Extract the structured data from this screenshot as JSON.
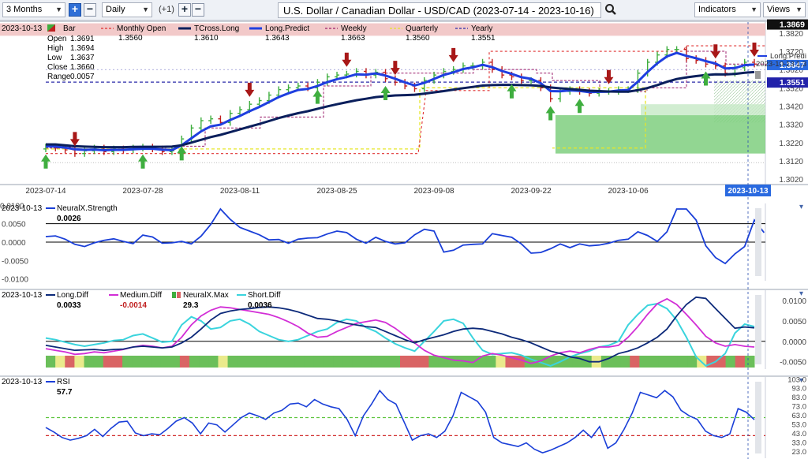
{
  "toolbar": {
    "period": "3 Months",
    "interval": "Daily",
    "offset": "(+1)",
    "title": "U.S. Dollar / Canadian Dollar - USD/CAD (2023-07-14 - 2023-10-16)",
    "indicators": "Indicators",
    "views": "Views"
  },
  "colors": {
    "tcross": "#0a1f5c",
    "longpredict": "#1f3fe0",
    "neuralx": "#1a3fd8",
    "longdiff": "#0d2a7a",
    "mediumdiff": "#d22ed6",
    "shortdiff": "#3ad4dd",
    "rsi": "#1a3fd8",
    "up": "#3fae3f",
    "down": "#c02020",
    "monthly": "#e03030",
    "weekly": "#9c1f6c",
    "quarterly": "#e6e62a",
    "yearly": "#2a2aa8"
  },
  "chart_data": [
    {
      "type": "line",
      "panel": "price",
      "title": "U.S. Dollar / Canadian Dollar - USD/CAD (2023-07-14 - 2023-10-16)",
      "date_label": "2023-10-13",
      "legend": [
        "Bar",
        "Monthly Open",
        "TCross.Long",
        "Long.Predict",
        "Weekly",
        "Quarterly",
        "Yearly"
      ],
      "ohlc_labels": [
        "Open",
        "High",
        "Low",
        "Close",
        "Range"
      ],
      "ohlc_values": [
        "1.3691",
        "1.3694",
        "1.3637",
        "1.3660",
        "0.0057"
      ],
      "legend_values": [
        "1.3560",
        "1.3610",
        "1.3643",
        "1.3663",
        "1.3560",
        "1.3551"
      ],
      "x_ticks": [
        "2023-07-14",
        "2023-07-28",
        "2023-08-11",
        "2023-08-25",
        "2023-09-08",
        "2023-09-22",
        "2023-10-06",
        "2023-10-13"
      ],
      "y_ticks": [
        1.382,
        1.372,
        1.362,
        1.352,
        1.342,
        1.332,
        1.322,
        1.312,
        1.302
      ],
      "ylim": [
        1.299,
        1.388
      ],
      "price_tags": {
        "top": "1.3869",
        "tcross": "1.3647",
        "yearly": "1.3551",
        "side_label": "Long.Predi",
        "side_date": "2023-10-13",
        "side_value": "1.3"
      },
      "close": [
        1.3195,
        1.319,
        1.318,
        1.316,
        1.3175,
        1.319,
        1.317,
        1.3185,
        1.318,
        1.319,
        1.3195,
        1.3185,
        1.317,
        1.3175,
        1.324,
        1.33,
        1.334,
        1.335,
        1.333,
        1.338,
        1.34,
        1.343,
        1.345,
        1.348,
        1.351,
        1.352,
        1.353,
        1.352,
        1.355,
        1.358,
        1.359,
        1.3595,
        1.361,
        1.359,
        1.3605,
        1.357,
        1.355,
        1.353,
        1.3515,
        1.356,
        1.359,
        1.361,
        1.362,
        1.364,
        1.364,
        1.366,
        1.362,
        1.359,
        1.358,
        1.356,
        1.356,
        1.352,
        1.346,
        1.35,
        1.351,
        1.35,
        1.349,
        1.35,
        1.35,
        1.351,
        1.351,
        1.36,
        1.366,
        1.37,
        1.373,
        1.373,
        1.368,
        1.367,
        1.365,
        1.364,
        1.36,
        1.363,
        1.366,
        1.365
      ],
      "tcross": [
        1.321,
        1.321,
        1.3205,
        1.32,
        1.3198,
        1.3196,
        1.3195,
        1.3195,
        1.3195,
        1.3196,
        1.3197,
        1.3197,
        1.3197,
        1.3198,
        1.3205,
        1.322,
        1.3235,
        1.325,
        1.3262,
        1.3277,
        1.3292,
        1.3307,
        1.3322,
        1.3338,
        1.3354,
        1.3368,
        1.3381,
        1.3392,
        1.3405,
        1.3418,
        1.343,
        1.3441,
        1.3452,
        1.346,
        1.3469,
        1.3474,
        1.3478,
        1.348,
        1.3482,
        1.3488,
        1.3495,
        1.3502,
        1.351,
        1.3518,
        1.3525,
        1.3532,
        1.3535,
        1.3536,
        1.3536,
        1.3535,
        1.3534,
        1.353,
        1.3522,
        1.3517,
        1.3513,
        1.3509,
        1.3504,
        1.3502,
        1.35,
        1.3499,
        1.3499,
        1.3507,
        1.3519,
        1.3535,
        1.3553,
        1.3568,
        1.3577,
        1.3584,
        1.359,
        1.3594,
        1.3593,
        1.3596,
        1.3602,
        1.3606
      ],
      "longpredict": [
        1.32,
        1.3198,
        1.3192,
        1.3183,
        1.318,
        1.3182,
        1.3178,
        1.318,
        1.318,
        1.3183,
        1.3186,
        1.3186,
        1.3181,
        1.3179,
        1.3205,
        1.3243,
        1.3281,
        1.3309,
        1.3318,
        1.3344,
        1.3366,
        1.3392,
        1.3415,
        1.3442,
        1.3469,
        1.349,
        1.3508,
        1.3514,
        1.353,
        1.3551,
        1.3567,
        1.3579,
        1.3594,
        1.3592,
        1.3599,
        1.3587,
        1.357,
        1.355,
        1.3533,
        1.3547,
        1.3569,
        1.359,
        1.3605,
        1.3623,
        1.3632,
        1.3646,
        1.3633,
        1.3612,
        1.3596,
        1.3578,
        1.3569,
        1.3545,
        1.3502,
        1.3501,
        1.3506,
        1.3503,
        1.3496,
        1.3498,
        1.3499,
        1.3505,
        1.3508,
        1.3554,
        1.3607,
        1.3654,
        1.3692,
        1.3711,
        1.3695,
        1.3682,
        1.3666,
        1.3653,
        1.3626,
        1.3628,
        1.3644,
        1.3647
      ],
      "up_arrows": [
        0,
        10,
        14,
        28,
        35,
        48,
        52,
        55,
        68
      ],
      "down_arrows": [
        3,
        21,
        31,
        36,
        42,
        58,
        69,
        73
      ]
    },
    {
      "type": "line",
      "panel": "NeuralX.Strength",
      "date_label": "2023-10-13",
      "legend": [
        "NeuralX.Strength"
      ],
      "legend_values": [
        "0.0026"
      ],
      "y_ticks": [
        0.01,
        0.005,
        0,
        -0.005,
        -0.01
      ],
      "y_tick_labels": [
        "0.0100",
        "0.0050",
        "0.0000",
        "-0.0050",
        "-0.0100"
      ],
      "ylim": [
        -0.0105,
        0.0105
      ],
      "values": [
        0.0015,
        0.0017,
        0.0008,
        -0.0006,
        -0.0012,
        -0.0002,
        0.0005,
        0.0009,
        0.0002,
        -0.0004,
        0.0019,
        0.0014,
        -0.0003,
        -0.0002,
        0.0002,
        -0.0005,
        0.0016,
        0.0048,
        0.009,
        0.0062,
        0.004,
        0.003,
        0.002,
        0.0006,
        0.0007,
        -0.0003,
        0.0008,
        0.0011,
        0.0012,
        0.0022,
        0.003,
        0.0026,
        0.0008,
        -0.0003,
        0.0013,
        0.0002,
        -0.0005,
        -0.0002,
        0.002,
        0.0035,
        0.003,
        -0.0027,
        -0.0022,
        -0.0008,
        -0.0006,
        -0.0005,
        0.0023,
        0.0018,
        0.0013,
        -0.0005,
        -0.003,
        -0.0028,
        -0.0018,
        -0.0005,
        -0.0015,
        -0.0005,
        -0.001,
        -0.0008,
        -0.0003,
        0.0005,
        0.0008,
        0.0028,
        0.0018,
        0.0002,
        0.0028,
        0.009,
        0.009,
        0.006,
        -0.001,
        -0.0042,
        -0.0058,
        -0.0032,
        -0.0012,
        0.006,
        0.0026
      ]
    },
    {
      "type": "line",
      "panel": "Diff",
      "date_label": "2023-10-13",
      "legend": [
        "Long.Diff",
        "Medium.Diff",
        "NeuralX.Max",
        "Short.Diff"
      ],
      "legend_values": [
        "0.0033",
        "-0.0014",
        "29.3",
        "0.0036"
      ],
      "y_ticks": [
        0.01,
        0.005,
        0,
        -0.005
      ],
      "y_tick_labels": [
        "0.0100",
        "0.0050",
        "0.0000",
        "-0.0050"
      ],
      "ylim": [
        -0.0068,
        0.0125
      ],
      "longdiff": [
        -0.001,
        -0.0014,
        -0.0018,
        -0.0022,
        -0.0021,
        -0.002,
        -0.0022,
        -0.002,
        -0.0019,
        -0.0014,
        -0.0012,
        -0.0014,
        -0.0016,
        -0.0014,
        -0.0004,
        0.001,
        0.003,
        0.0052,
        0.0068,
        0.0074,
        0.0078,
        0.008,
        0.0083,
        0.0084,
        0.0082,
        0.0078,
        0.0072,
        0.0064,
        0.0056,
        0.0054,
        0.005,
        0.0044,
        0.004,
        0.0036,
        0.0034,
        0.0024,
        0.0014,
        0.0004,
        -0.0004,
        0.0004,
        0.001,
        0.0016,
        0.0024,
        0.003,
        0.0032,
        0.003,
        0.0024,
        0.0018,
        0.001,
        0.0004,
        -0.0004,
        -0.0014,
        -0.0024,
        -0.003,
        -0.0038,
        -0.0042,
        -0.005,
        -0.005,
        -0.0042,
        -0.003,
        -0.0024,
        -0.0016,
        -0.0004,
        0.001,
        0.003,
        0.0062,
        0.009,
        0.0108,
        0.0105,
        0.008,
        0.0056,
        0.0032,
        0.0035,
        0.0033
      ],
      "mediumdiff": [
        -0.0018,
        -0.0022,
        -0.0026,
        -0.0032,
        -0.003,
        -0.0026,
        -0.0028,
        -0.0024,
        -0.002,
        -0.0014,
        -0.001,
        -0.0012,
        -0.0016,
        -0.0012,
        0.001,
        0.004,
        0.0062,
        0.0076,
        0.0084,
        0.0082,
        0.0078,
        0.0074,
        0.007,
        0.0066,
        0.0058,
        0.0048,
        0.0036,
        0.002,
        0.001,
        0.0012,
        0.0024,
        0.0034,
        0.0044,
        0.0048,
        0.0052,
        0.0046,
        0.0032,
        0.0014,
        -0.0004,
        -0.0022,
        -0.0034,
        -0.004,
        -0.0046,
        -0.0048,
        -0.0052,
        -0.0036,
        -0.003,
        -0.0034,
        -0.004,
        -0.0046,
        -0.0054,
        -0.0048,
        -0.0036,
        -0.0028,
        -0.0024,
        -0.0028,
        -0.002,
        -0.0014,
        -0.0014,
        -0.001,
        0.001,
        0.0036,
        0.0066,
        0.0092,
        0.0104,
        0.009,
        0.0066,
        0.004,
        0.0012,
        -0.0004,
        -0.0012,
        -0.0008,
        -0.0012,
        -0.0014
      ],
      "shortdiff": [
        0.0008,
        0.0004,
        -0.0002,
        -0.0008,
        -0.0012,
        -0.0008,
        -0.0004,
        0.0002,
        0.0004,
        0.0014,
        0.0018,
        0.0008,
        -0.0002,
        0.0,
        0.004,
        0.006,
        0.005,
        0.003,
        0.0034,
        0.005,
        0.0054,
        0.0042,
        0.0024,
        0.0014,
        0.0004,
        0.0,
        0.0004,
        0.0014,
        0.0024,
        0.003,
        0.0046,
        0.0054,
        0.005,
        0.0034,
        0.0024,
        0.0008,
        -0.0006,
        -0.0016,
        -0.0024,
        0.0,
        0.0024,
        0.005,
        0.0054,
        0.0044,
        0.0008,
        -0.0022,
        -0.0032,
        -0.003,
        -0.0028,
        -0.0034,
        -0.0044,
        -0.0052,
        -0.006,
        -0.005,
        -0.0038,
        -0.003,
        -0.0024,
        -0.0014,
        -0.001,
        0.0,
        0.004,
        0.0066,
        0.0088,
        0.0092,
        0.008,
        0.0052,
        0.001,
        -0.0038,
        -0.006,
        -0.005,
        -0.003,
        0.002,
        0.0042,
        0.0036
      ],
      "maxbar": [
        "g",
        "y",
        "r",
        "y",
        "g",
        "g",
        "r",
        "r",
        "g",
        "g",
        "g",
        "g",
        "g",
        "g",
        "r",
        "g",
        "g",
        "g",
        "y",
        "g",
        "g",
        "g",
        "g",
        "g",
        "g",
        "g",
        "g",
        "g",
        "g",
        "g",
        "g",
        "g",
        "g",
        "g",
        "g",
        "g",
        "g",
        "r",
        "r",
        "r",
        "g",
        "g",
        "g",
        "g",
        "g",
        "g",
        "g",
        "y",
        "r",
        "r",
        "g",
        "g",
        "g",
        "g",
        "g",
        "g",
        "g",
        "y",
        "g",
        "g",
        "g",
        "r",
        "g",
        "g",
        "g",
        "g",
        "g",
        "g",
        "y",
        "r",
        "r",
        "g",
        "r",
        "g"
      ]
    },
    {
      "type": "line",
      "panel": "RSI",
      "date_label": "2023-10-13",
      "legend": [
        "RSI"
      ],
      "legend_values": [
        "57.7"
      ],
      "y_ticks": [
        103,
        93,
        83,
        73,
        63,
        53,
        43,
        33,
        23
      ],
      "y_tick_labels": [
        "103.0",
        "93.0",
        "83.0",
        "73.0",
        "63.0",
        "53.0",
        "43.0",
        "33.0",
        "23.0"
      ],
      "ylim": [
        15,
        105
      ],
      "upper": 60,
      "lower": 40,
      "values": [
        49,
        44,
        38,
        35,
        37,
        40,
        47,
        39,
        48,
        55,
        56,
        43,
        40,
        42,
        41,
        48,
        56,
        60,
        54,
        42,
        54,
        52,
        44,
        52,
        60,
        65,
        62,
        58,
        65,
        68,
        75,
        76,
        72,
        80,
        75,
        72,
        70,
        58,
        40,
        62,
        75,
        90,
        80,
        75,
        55,
        35,
        40,
        42,
        38,
        45,
        62,
        88,
        83,
        78,
        66,
        38,
        32,
        30,
        28,
        32,
        25,
        21,
        24,
        28,
        32,
        38,
        46,
        38,
        50,
        26,
        32,
        47,
        65,
        88,
        85,
        82,
        90,
        83,
        68,
        62,
        58,
        45,
        40,
        38,
        42,
        70,
        66,
        57.7
      ]
    }
  ]
}
